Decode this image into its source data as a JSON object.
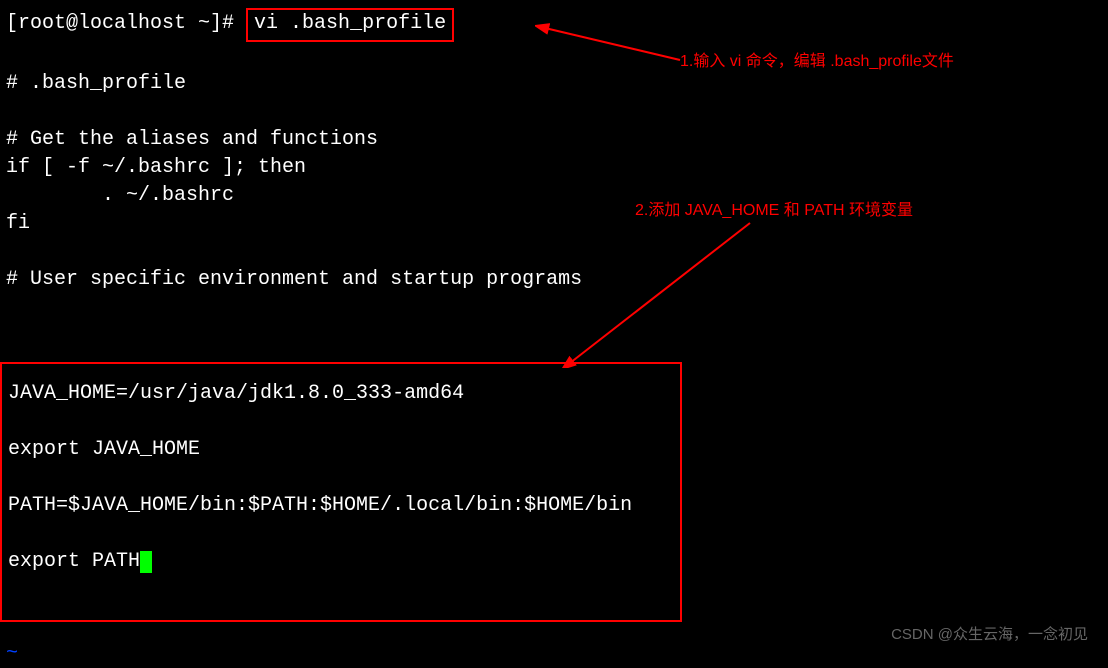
{
  "prompt": "[root@localhost ~]# ",
  "command": "vi .bash_profile",
  "file_lines": {
    "l1": "# .bash_profile",
    "l2": "# Get the aliases and functions",
    "l3": "if [ -f ~/.bashrc ]; then",
    "l4": "        . ~/.bashrc",
    "l5": "fi",
    "l6": "# User specific environment and startup programs"
  },
  "env_block": {
    "l1": "JAVA_HOME=/usr/java/jdk1.8.0_333-amd64",
    "l2": "export JAVA_HOME",
    "l3": "PATH=$JAVA_HOME/bin:$PATH:$HOME/.local/bin:$HOME/bin",
    "l4": "export PATH"
  },
  "annotations": {
    "a1": "1.输入 vi 命令，编辑 .bash_profile文件",
    "a2": "2.添加 JAVA_HOME 和 PATH 环境变量"
  },
  "watermark": "CSDN @众生云海，一念初见",
  "tilde": "~"
}
